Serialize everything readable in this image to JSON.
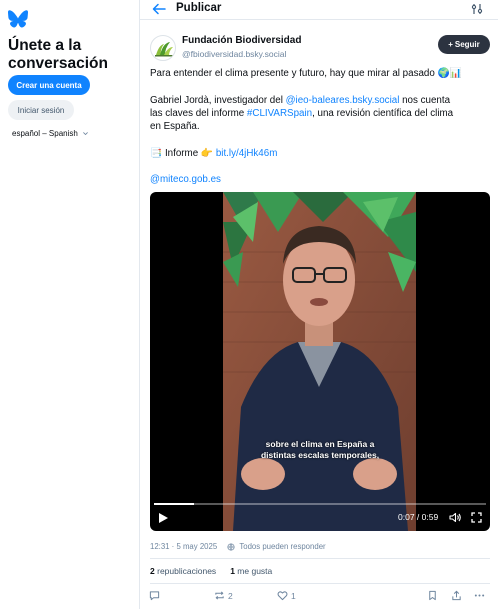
{
  "sidebar": {
    "title": "Únete a la conversación",
    "create_account": "Crear una cuenta",
    "login": "Iniciar sesión",
    "language": "español – Spanish"
  },
  "header": {
    "title": "Publicar"
  },
  "post": {
    "author_name": "Fundación Biodiversidad",
    "author_handle": "@fbiodiversidad.bsky.social",
    "follow_label": "Seguir",
    "line1": "Para entender el clima presente y futuro, hay que mirar al pasado 🌍📊",
    "para2_a": "Gabriel Jordà, investigador del ",
    "para2_link": "@ieo-baleares.bsky.social",
    "para2_b": " nos cuenta",
    "para2_line2_a": "las claves del informe ",
    "para2_hashtag": "#CLIVARSpain",
    "para2_line2_b": ", una revisión científica del clima",
    "para2_line3": "en España.",
    "informe_icon": "📑",
    "informe_label": "Informe",
    "informe_pointer": "👉",
    "informe_link": "bit.ly/4jHk46m",
    "mention": "@miteco.gob.es",
    "video": {
      "caption_line1": "sobre el clima en España a",
      "caption_line2": "distintas escalas temporales,",
      "time": "0:07 / 0:59",
      "progress": 0.12
    },
    "timestamp": "12:31 · 5 may 2025",
    "reply_setting": "Todos pueden responder",
    "reposts_count": "2",
    "reposts_label": "republicaciones",
    "likes_count": "1",
    "likes_label": "me gusta",
    "actions": {
      "repost_count": "2",
      "like_count": "1"
    }
  },
  "colors": {
    "accent": "#1083fe",
    "text": "#0b0f14",
    "muted": "#6f869f"
  }
}
